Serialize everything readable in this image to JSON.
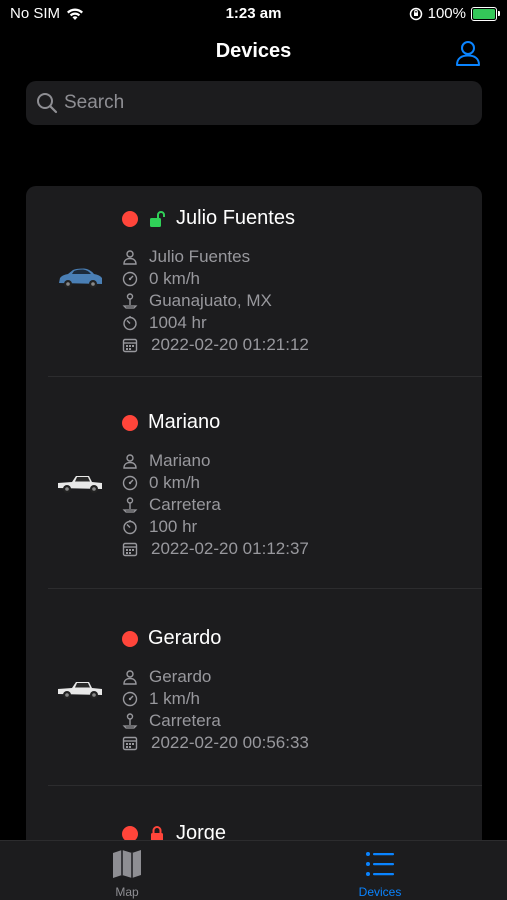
{
  "status_bar": {
    "carrier": "No SIM",
    "time": "1:23 am",
    "battery": "100%",
    "battery_level": 1.0
  },
  "nav": {
    "title": "Devices",
    "profile_icon": "person-icon"
  },
  "search": {
    "placeholder": "Search",
    "value": ""
  },
  "devices": [
    {
      "name": "Julio Fuentes",
      "status_color": "#ff453a",
      "lock": "unlocked",
      "car_color": "#4a7fb5",
      "driver": "Julio Fuentes",
      "speed": "0 km/h",
      "location": "Guanajuato, MX",
      "hours": "1004 hr",
      "datetime": "2022-02-20 01:21:12"
    },
    {
      "name": "Mariano",
      "status_color": "#ff453a",
      "lock": "none",
      "car_color": "#e8e8e8",
      "driver": "Mariano",
      "speed": "0 km/h",
      "location": "Carretera",
      "hours": "100 hr",
      "datetime": "2022-02-20 01:12:37"
    },
    {
      "name": "Gerardo",
      "status_color": "#ff453a",
      "lock": "none",
      "car_color": "#e8e8e8",
      "driver": "Gerardo",
      "speed": "1 km/h",
      "location": "Carretera",
      "datetime": "2022-02-20 00:56:33"
    },
    {
      "name": "Jorge",
      "status_color": "#ff453a",
      "lock": "locked"
    }
  ],
  "tabs": [
    {
      "label": "Map",
      "icon": "map-icon",
      "active": false
    },
    {
      "label": "Devices",
      "icon": "list-icon",
      "active": true
    }
  ],
  "colors": {
    "accent": "#0a84ff",
    "status_offline": "#ff453a",
    "unlocked": "#30d158",
    "locked": "#ff453a",
    "inactive_tab": "#8e8e93"
  }
}
